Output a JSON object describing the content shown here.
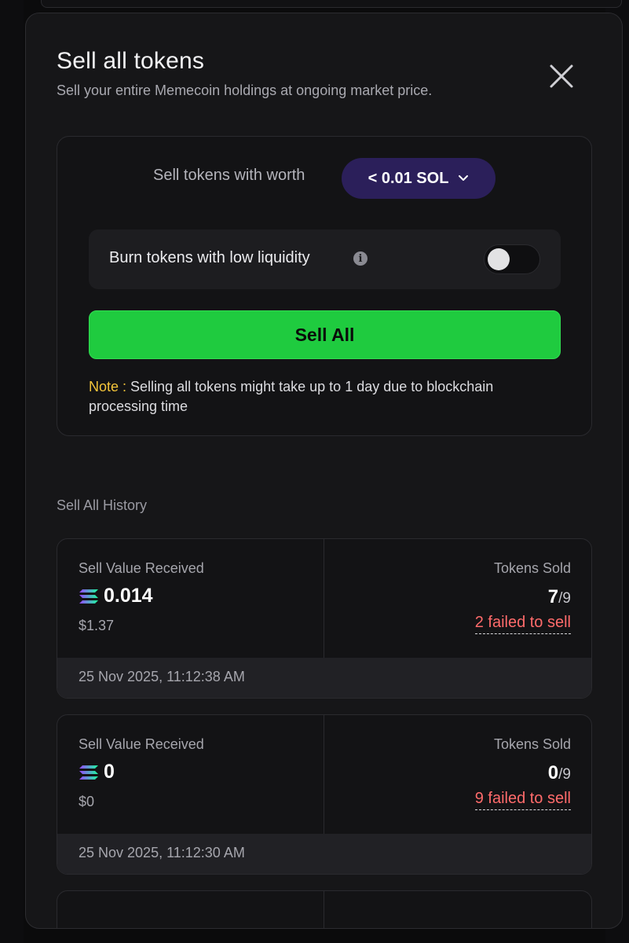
{
  "modal": {
    "title": "Sell all tokens",
    "subtitle": "Sell your entire Memecoin holdings at ongoing market price."
  },
  "settings": {
    "worth_label": "Sell tokens with worth",
    "worth_selected": "< 0.01 SOL",
    "burn_label": "Burn tokens with low liquidity",
    "burn_enabled": false,
    "sell_all_label": "Sell All",
    "note_prefix": "Note :",
    "note_text": " Selling all tokens might take up to 1 day due to blockchain processing time"
  },
  "history": {
    "title": "Sell All History",
    "entries": [
      {
        "value_label": "Sell Value Received",
        "value": "0.014",
        "usd": "$1.37",
        "tokens_label": "Tokens Sold",
        "sold": "7",
        "separator": "/",
        "total": "9",
        "failed": "2 failed to sell",
        "timestamp": "25 Nov 2025, 11:12:38 AM"
      },
      {
        "value_label": "Sell Value Received",
        "value": "0",
        "usd": "$0",
        "tokens_label": "Tokens Sold",
        "sold": "0",
        "separator": "/",
        "total": "9",
        "failed": "9 failed to sell",
        "timestamp": "25 Nov 2025, 11:12:30 AM"
      }
    ]
  },
  "colors": {
    "accent_green": "#1fcb3f",
    "select_purple": "#2b1f5a",
    "failed_red": "#ff6b6b",
    "note_yellow": "#f3c43a"
  },
  "icons": {
    "close": "close-icon",
    "chevron": "chevron-down-icon",
    "info": "info-icon",
    "solana": "solana-icon"
  }
}
